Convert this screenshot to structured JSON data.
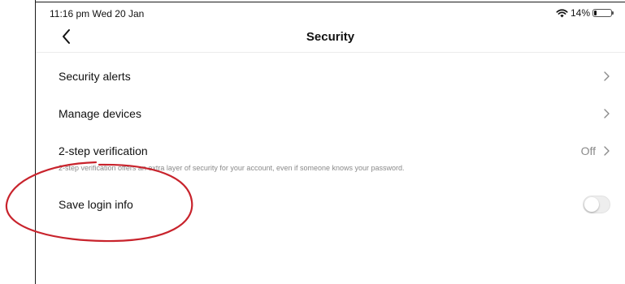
{
  "status_bar": {
    "time": "11:16 pm  Wed 20 Jan",
    "battery_text": "14%",
    "battery_level": 0.14,
    "wifi_icon": "wifi-icon",
    "battery_icon": "battery-icon"
  },
  "nav": {
    "title": "Security",
    "back_icon": "chevron-left-icon"
  },
  "settings": [
    {
      "label": "Security alerts",
      "control": "chevron"
    },
    {
      "label": "Manage devices",
      "control": "chevron"
    },
    {
      "label": "2-step verification",
      "value": "Off",
      "control": "chevron",
      "description": "2-step verification offers an extra layer of security for your account, even if someone knows your password."
    },
    {
      "label": "Save login info",
      "control": "toggle",
      "toggle_on": false
    }
  ],
  "colors": {
    "annotation": "#c8232c",
    "secondary_text": "#8a8a8a",
    "toggle_off": "#eeeeee"
  }
}
